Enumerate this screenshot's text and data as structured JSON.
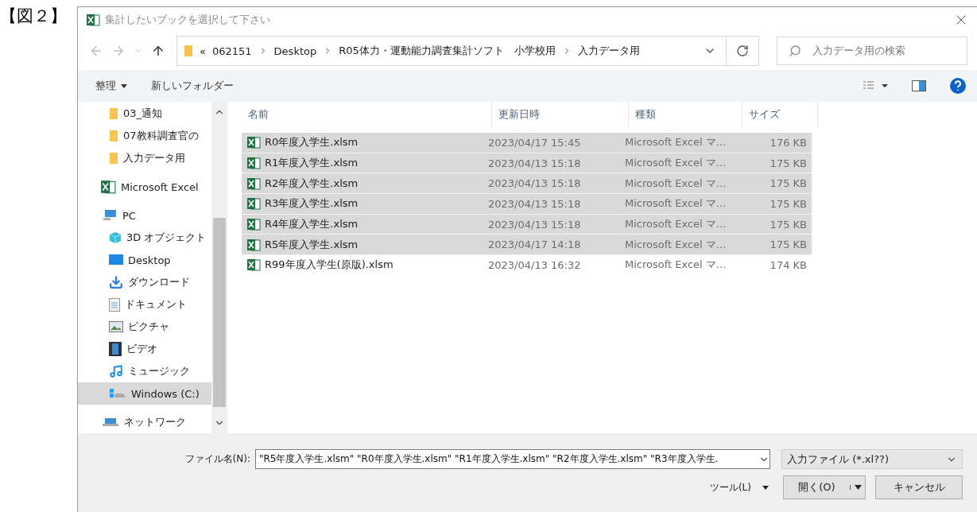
{
  "figure_label": "【図２】",
  "window": {
    "title": "集計したいブックを選択して下さい"
  },
  "address": {
    "crumbs": [
      "«",
      "062151",
      "Desktop",
      "R05体力・運動能力調査集計ソフト　小学校用",
      "入力データ用"
    ]
  },
  "search": {
    "placeholder": "入力データ用の検索"
  },
  "toolbar": {
    "organize": "整理",
    "new_folder": "新しいフォルダー"
  },
  "sidebar": {
    "items": [
      {
        "label": "03_通知",
        "kind": "folder",
        "selected": false
      },
      {
        "label": "07教科調査官の",
        "kind": "folder",
        "selected": false
      },
      {
        "label": "入力データ用",
        "kind": "folder",
        "selected": false
      },
      {
        "label": "Microsoft Excel",
        "kind": "app",
        "selected": false
      },
      {
        "label": "PC",
        "kind": "computer",
        "selected": false,
        "children": [
          {
            "label": "3D オブジェクト",
            "kind": "objects",
            "selected": false
          },
          {
            "label": "Desktop",
            "kind": "desktop",
            "selected": false
          },
          {
            "label": "ダウンロード",
            "kind": "downloads",
            "selected": false
          },
          {
            "label": "ドキュメント",
            "kind": "documents",
            "selected": false
          },
          {
            "label": "ピクチャ",
            "kind": "pictures",
            "selected": false
          },
          {
            "label": "ビデオ",
            "kind": "videos",
            "selected": false
          },
          {
            "label": "ミュージック",
            "kind": "music",
            "selected": false
          },
          {
            "label": "Windows (C:)",
            "kind": "drive",
            "selected": true
          }
        ]
      },
      {
        "label": "ネットワーク",
        "kind": "network",
        "selected": false
      }
    ]
  },
  "table": {
    "columns": [
      "名前",
      "更新日時",
      "種類",
      "サイズ"
    ],
    "rows": [
      {
        "name": "R0年度入学生.xlsm",
        "date": "2023/04/17 15:45",
        "type": "Microsoft Excel マ...",
        "size": "176 KB",
        "selected": true
      },
      {
        "name": "R1年度入学生.xlsm",
        "date": "2023/04/13 15:18",
        "type": "Microsoft Excel マ...",
        "size": "175 KB",
        "selected": true
      },
      {
        "name": "R2年度入学生.xlsm",
        "date": "2023/04/13 15:18",
        "type": "Microsoft Excel マ...",
        "size": "175 KB",
        "selected": true
      },
      {
        "name": "R3年度入学生.xlsm",
        "date": "2023/04/13 15:18",
        "type": "Microsoft Excel マ...",
        "size": "175 KB",
        "selected": true
      },
      {
        "name": "R4年度入学生.xlsm",
        "date": "2023/04/13 15:18",
        "type": "Microsoft Excel マ...",
        "size": "175 KB",
        "selected": true
      },
      {
        "name": "R5年度入学生.xlsm",
        "date": "2023/04/17 14:18",
        "type": "Microsoft Excel マ...",
        "size": "175 KB",
        "selected": true
      },
      {
        "name": "R99年度入学生(原版).xlsm",
        "date": "2023/04/13 16:32",
        "type": "Microsoft Excel マ...",
        "size": "174 KB",
        "selected": false
      }
    ]
  },
  "footer": {
    "filename_label": "ファイル名(N):",
    "filename_value": "\"R5年度入学生.xlsm\" \"R0年度入学生.xlsm\" \"R1年度入学生.xlsm\" \"R2年度入学生.xlsm\" \"R3年度入学生.",
    "filter": "入力ファイル (*.xl??)",
    "tools": "ツール(L)",
    "open": "開く(O)",
    "cancel": "キャンセル"
  }
}
